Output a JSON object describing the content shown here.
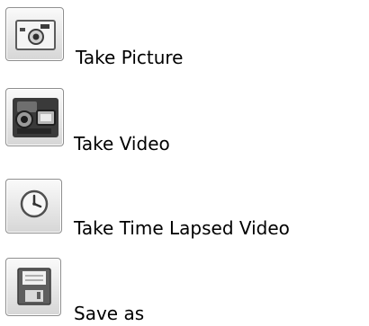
{
  "actions": [
    {
      "icon": "camera-icon",
      "label": "Take Picture"
    },
    {
      "icon": "video-camera-icon",
      "label": "Take Video"
    },
    {
      "icon": "clock-icon",
      "label": "Take Time Lapsed Video"
    },
    {
      "icon": "floppy-disk-icon",
      "label": "Save as"
    }
  ]
}
